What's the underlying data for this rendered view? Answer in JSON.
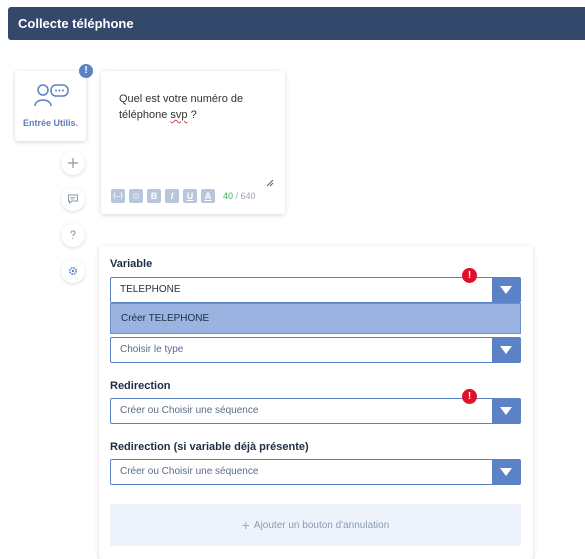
{
  "header": {
    "title": "Collecte téléphone"
  },
  "node": {
    "label": "Entrée Utilis.",
    "info_badge": "!"
  },
  "side_buttons": [
    {
      "icon": "plus-icon"
    },
    {
      "icon": "chat-icon"
    },
    {
      "icon": "question-icon"
    },
    {
      "icon": "gear-icon"
    }
  ],
  "message": {
    "line1": "Quel est votre numéro de",
    "line2_pre": "téléphone ",
    "line2_underlined": "svp",
    "line2_post": " ?",
    "char_count_current": "40",
    "char_count_sep": " / ",
    "char_count_max": "640",
    "format_buttons": [
      "{...}",
      "☺",
      "B",
      "I",
      "U",
      "A"
    ]
  },
  "form": {
    "variable_label": "Variable",
    "variable_value": "TELEPHONE",
    "variable_error": "!",
    "dropdown_option": "Créer TELEPHONE",
    "type_placeholder": "Choisir le type",
    "redirection_label": "Redirection",
    "redirection_placeholder": "Créer ou Choisir une séquence",
    "redirection_error": "!",
    "redirection2_label": "Redirection (si variable déjà présente)",
    "redirection2_placeholder": "Créer ou Choisir une séquence",
    "cancel_button_label": "Ajouter un bouton d'annulation",
    "cancel_button_icon": "+"
  },
  "colors": {
    "header_bg": "#33486b",
    "accent": "#5b82c6",
    "error": "#e0102a",
    "option_highlight": "#9ab3e0"
  }
}
